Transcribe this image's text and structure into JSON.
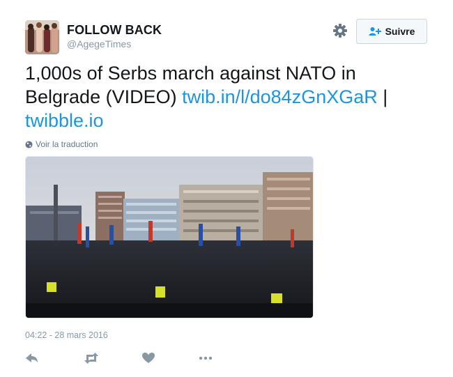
{
  "user": {
    "display_name": "FOLLOW BACK",
    "handle": "@AgegeTimes"
  },
  "header": {
    "settings_icon": "gear-icon",
    "follow_label": "Suivre",
    "follow_icon": "add-user-icon"
  },
  "tweet": {
    "text_plain": "1,000s of Serbs march against NATO in Belgrade (VIDEO) ",
    "link1": "twib.in/l/do84zGnXGaR",
    "separator": " | ",
    "link2": "twibble.io"
  },
  "translate": {
    "icon": "globe-icon",
    "label": "Voir la traduction"
  },
  "meta": {
    "timestamp": "04:22 - 28 mars 2016"
  },
  "actions": {
    "reply_icon": "reply-icon",
    "retweet_icon": "retweet-icon",
    "like_icon": "heart-icon",
    "more_icon": "more-icon"
  },
  "colors": {
    "link": "#1b95e0",
    "muted": "#8899a6",
    "text": "#14171a",
    "button_border": "#ccd6dd"
  }
}
